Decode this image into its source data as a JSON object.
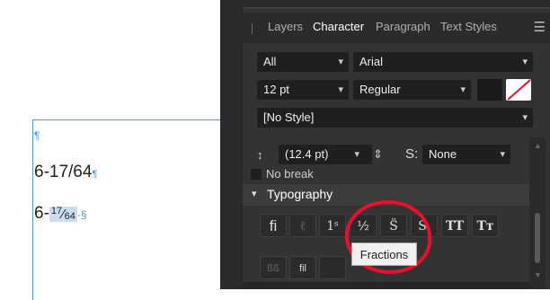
{
  "document": {
    "para_mark": "¶",
    "line1": {
      "text": "6-17/64",
      "mark": "¶"
    },
    "line2": {
      "prefix": "6-",
      "numerator": "17",
      "slash": "⁄",
      "denominator": "64",
      "mark": "·§"
    }
  },
  "panel": {
    "tabs": [
      {
        "label": "Layers",
        "active": false
      },
      {
        "label": "Character",
        "active": true
      },
      {
        "label": "Paragraph",
        "active": false
      },
      {
        "label": "Text Styles",
        "active": false
      }
    ],
    "menu_icon": "hamburger-menu-icon",
    "scope_dropdown": "All",
    "font_family": "Arial",
    "font_size": "12 pt",
    "font_style": "Regular",
    "style_dropdown": "[No Style]",
    "leading_value": "(12.4 pt)",
    "superscript_label": "S:",
    "superscript_value": "None",
    "no_break_label": "No break",
    "typography_title": "Typography",
    "typography_buttons": [
      {
        "label": "fi",
        "icon": "ligatures-icon",
        "dim": false
      },
      {
        "label": "ℓ",
        "icon": "discretionary-ligature-icon",
        "dim": true
      },
      {
        "label": "1ˢ",
        "icon": "ordinals-icon",
        "dim": false
      },
      {
        "label": "½",
        "icon": "fractions-icon",
        "dim": false
      },
      {
        "label": "S̈",
        "icon": "superscript-icon",
        "dim": false
      },
      {
        "label": "S.",
        "icon": "subscript-icon",
        "dim": false
      },
      {
        "label": "TT",
        "icon": "all-caps-icon",
        "dim": false
      },
      {
        "label": "Tт",
        "icon": "small-caps-icon",
        "dim": false
      }
    ],
    "typography_row2": [
      {
        "label": "ßß",
        "icon": "alternate-glyph-icon",
        "dim": true
      },
      {
        "label": "fil",
        "icon": "contextual-alternates-icon",
        "dim": false
      },
      {
        "label": "",
        "icon": "hidden-option-icon",
        "dim": true
      }
    ],
    "tooltip": "Fractions",
    "colors": {
      "panel_bg": "#333333",
      "accent_red": "#e8112d",
      "selection": "#c9def3"
    }
  }
}
